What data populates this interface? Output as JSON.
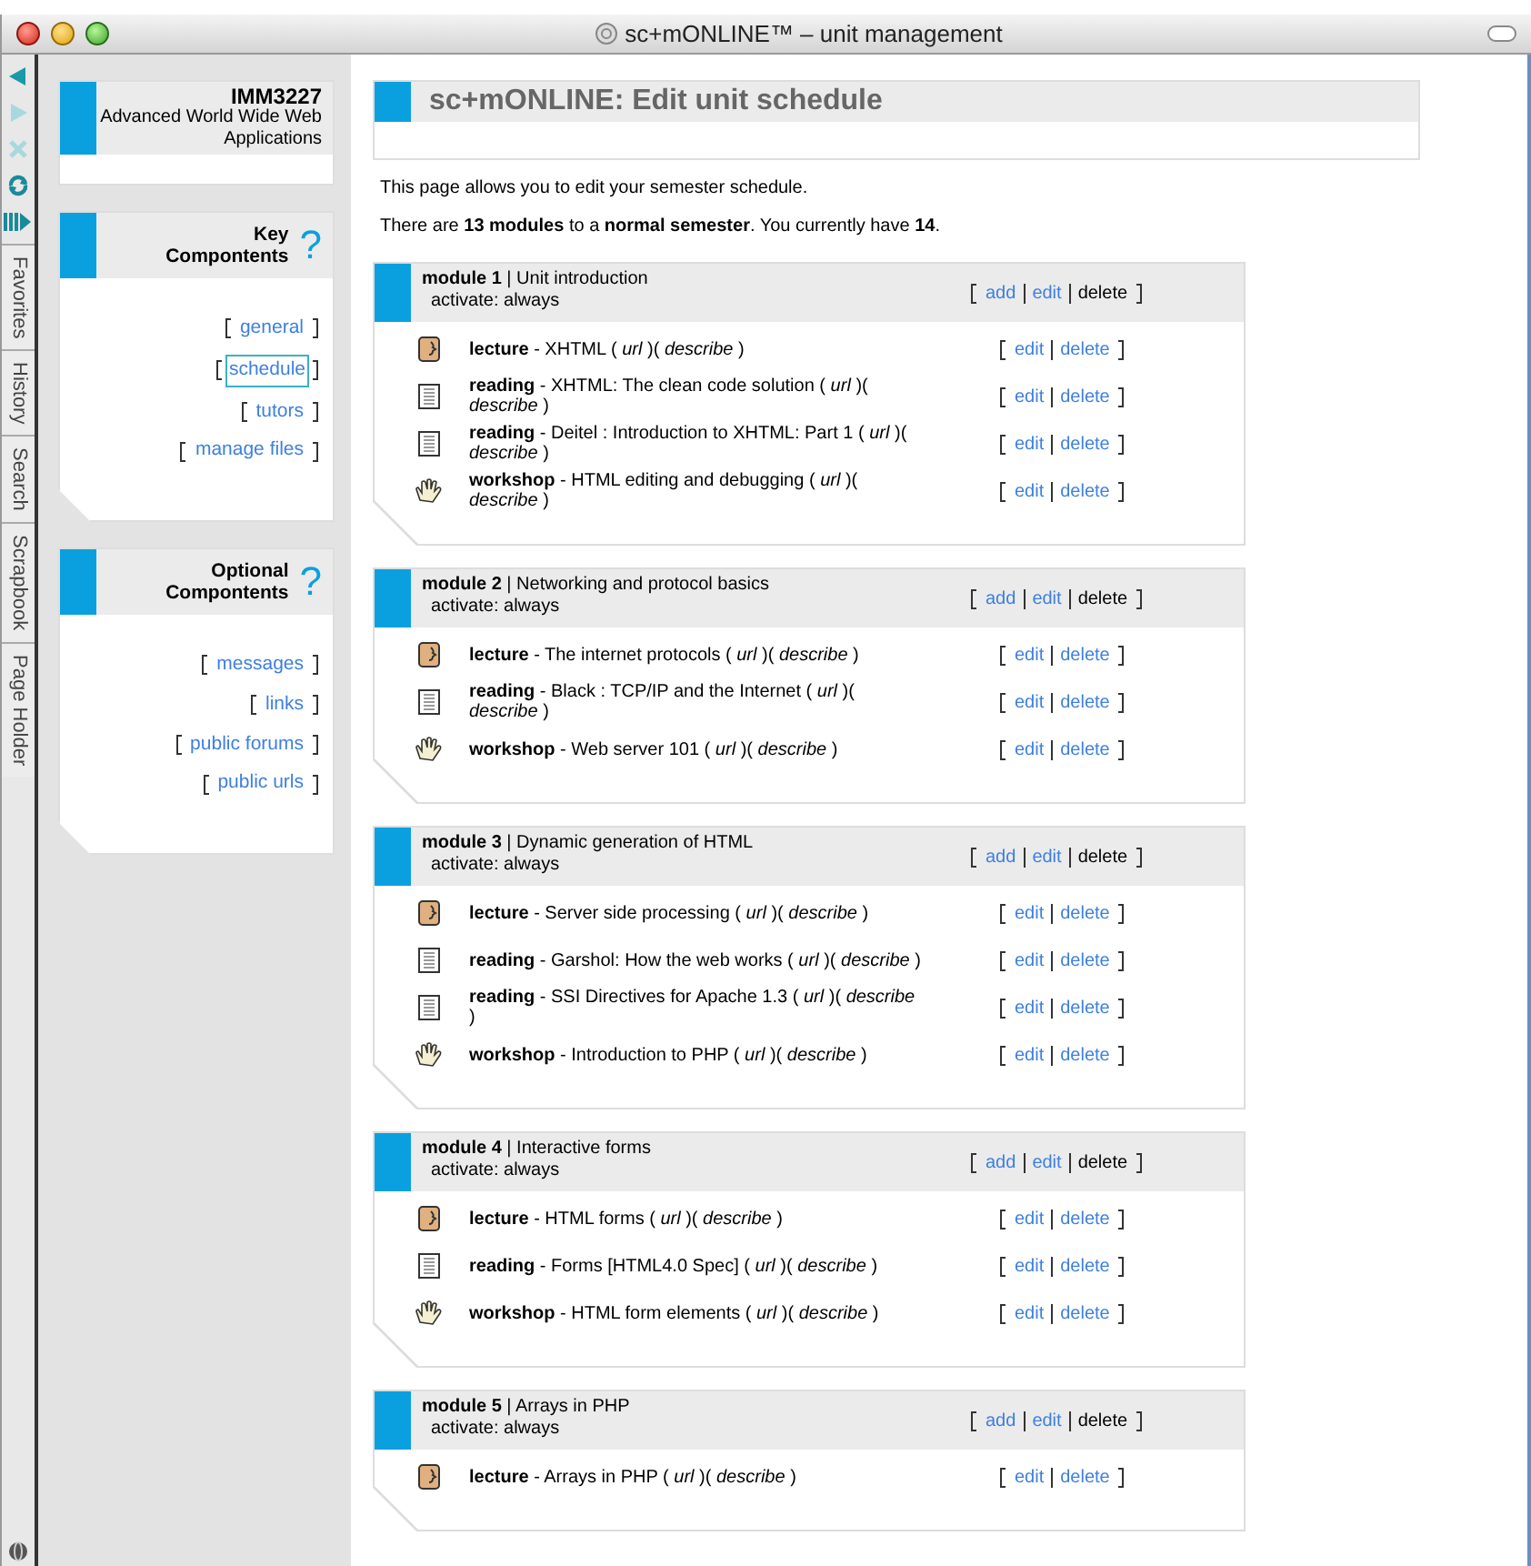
{
  "window": {
    "title": "sc+mONLINE™ – unit management"
  },
  "browser_tabs": [
    {
      "label": "Favorites"
    },
    {
      "label": "History"
    },
    {
      "label": "Search"
    },
    {
      "label": "Scrapbook"
    },
    {
      "label": "Page Holder"
    }
  ],
  "unit": {
    "code": "IMM3227",
    "name": "Advanced World Wide Web Applications"
  },
  "panels": [
    {
      "title": "Key Compontents",
      "help": "?",
      "links": [
        {
          "label": "general",
          "selected": false
        },
        {
          "label": "schedule",
          "selected": true
        },
        {
          "label": "tutors",
          "selected": false
        },
        {
          "label": "manage files",
          "selected": false
        }
      ]
    },
    {
      "title": "Optional Compontents",
      "help": "?",
      "links": [
        {
          "label": "messages",
          "selected": false
        },
        {
          "label": "links",
          "selected": false
        },
        {
          "label": "public forums",
          "selected": false
        },
        {
          "label": "public urls",
          "selected": false
        }
      ]
    }
  ],
  "heading": "sc+mONLINE: Edit unit schedule",
  "intro": [
    "This page allows you to edit your semester schedule.",
    "There are **13 modules** to a **normal semester**. You currently have **14**."
  ],
  "modules": [
    {
      "title": "**module 1** | Unit introduction",
      "activate": "activate: always",
      "actions": [
        {
          "label": "add",
          "link": true
        },
        {
          "label": "edit",
          "link": true
        },
        {
          "label": "delete",
          "link": false
        }
      ],
      "items": [
        {
          "kind": "lecture",
          "text": "**lecture** - XHTML ( *url* )( *describe* )",
          "actions": [
            {
              "label": "edit",
              "link": true
            },
            {
              "label": "delete",
              "link": true
            }
          ]
        },
        {
          "kind": "reading",
          "text": "**reading** - XHTML: The clean code solution ( *url* )( *describe* )",
          "actions": [
            {
              "label": "edit",
              "link": true
            },
            {
              "label": "delete",
              "link": true
            }
          ]
        },
        {
          "kind": "reading",
          "text": "**reading** - Deitel : Introduction to XHTML: Part 1 ( *url* )( *describe* )",
          "actions": [
            {
              "label": "edit",
              "link": true
            },
            {
              "label": "delete",
              "link": true
            }
          ]
        },
        {
          "kind": "workshop",
          "text": "**workshop** - HTML editing and debugging ( *url* )( *describe* )",
          "actions": [
            {
              "label": "edit",
              "link": true
            },
            {
              "label": "delete",
              "link": true
            }
          ]
        }
      ]
    },
    {
      "title": "**module 2** | Networking and protocol basics",
      "activate": "activate: always",
      "actions": [
        {
          "label": "add",
          "link": true
        },
        {
          "label": "edit",
          "link": true
        },
        {
          "label": "delete",
          "link": false
        }
      ],
      "items": [
        {
          "kind": "lecture",
          "text": "**lecture** - The internet protocols ( *url* )( *describe* )",
          "actions": [
            {
              "label": "edit",
              "link": true
            },
            {
              "label": "delete",
              "link": true
            }
          ]
        },
        {
          "kind": "reading",
          "text": "**reading** - Black : TCP/IP and the Internet ( *url* )( *describe* )",
          "actions": [
            {
              "label": "edit",
              "link": true
            },
            {
              "label": "delete",
              "link": true
            }
          ]
        },
        {
          "kind": "workshop",
          "text": "**workshop** - Web server 101 ( *url* )( *describe* )",
          "actions": [
            {
              "label": "edit",
              "link": true
            },
            {
              "label": "delete",
              "link": true
            }
          ]
        }
      ]
    },
    {
      "title": "**module 3** | Dynamic generation of HTML",
      "activate": "activate: always",
      "actions": [
        {
          "label": "add",
          "link": true
        },
        {
          "label": "edit",
          "link": true
        },
        {
          "label": "delete",
          "link": false
        }
      ],
      "items": [
        {
          "kind": "lecture",
          "text": "**lecture** - Server side processing ( *url* )( *describe* )",
          "actions": [
            {
              "label": "edit",
              "link": true
            },
            {
              "label": "delete",
              "link": true
            }
          ]
        },
        {
          "kind": "reading",
          "text": "**reading** - Garshol: How the web works ( *url* )( *describe* )",
          "actions": [
            {
              "label": "edit",
              "link": true
            },
            {
              "label": "delete",
              "link": true
            }
          ]
        },
        {
          "kind": "reading",
          "text": "**reading** - SSI Directives for Apache 1.3 ( *url* )( *describe* )",
          "actions": [
            {
              "label": "edit",
              "link": true
            },
            {
              "label": "delete",
              "link": true
            }
          ]
        },
        {
          "kind": "workshop",
          "text": "**workshop** - Introduction to PHP ( *url* )( *describe* )",
          "actions": [
            {
              "label": "edit",
              "link": true
            },
            {
              "label": "delete",
              "link": true
            }
          ]
        }
      ]
    },
    {
      "title": "**module 4** | Interactive forms",
      "activate": "activate: always",
      "actions": [
        {
          "label": "add",
          "link": true
        },
        {
          "label": "edit",
          "link": true
        },
        {
          "label": "delete",
          "link": false
        }
      ],
      "items": [
        {
          "kind": "lecture",
          "text": "**lecture** - HTML forms ( *url* )( *describe* )",
          "actions": [
            {
              "label": "edit",
              "link": true
            },
            {
              "label": "delete",
              "link": true
            }
          ]
        },
        {
          "kind": "reading",
          "text": "**reading** - Forms [HTML4.0 Spec] ( *url* )( *describe* )",
          "actions": [
            {
              "label": "edit",
              "link": true
            },
            {
              "label": "delete",
              "link": true
            }
          ]
        },
        {
          "kind": "workshop",
          "text": "**workshop** - HTML form elements ( *url* )( *describe* )",
          "actions": [
            {
              "label": "edit",
              "link": true
            },
            {
              "label": "delete",
              "link": true
            }
          ]
        }
      ]
    },
    {
      "title": "**module 5** | Arrays in PHP",
      "activate": "activate: always",
      "actions": [
        {
          "label": "add",
          "link": true
        },
        {
          "label": "edit",
          "link": true
        },
        {
          "label": "delete",
          "link": false
        }
      ],
      "items": [
        {
          "kind": "lecture",
          "text": "**lecture** - Arrays in PHP ( *url* )( *describe* )",
          "actions": [
            {
              "label": "edit",
              "link": true
            },
            {
              "label": "delete",
              "link": true
            }
          ]
        }
      ]
    }
  ]
}
